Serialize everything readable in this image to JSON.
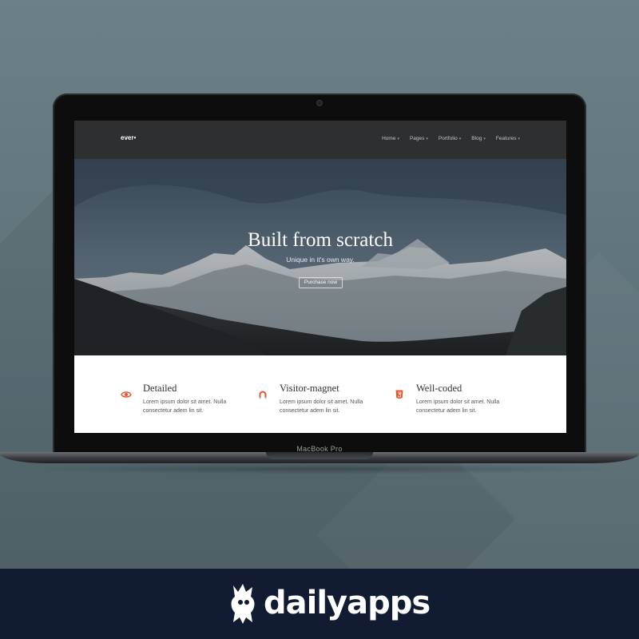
{
  "site": {
    "logo": "ever•",
    "nav": [
      {
        "label": "Home"
      },
      {
        "label": "Pages"
      },
      {
        "label": "Portfolio"
      },
      {
        "label": "Blog"
      },
      {
        "label": "Features"
      }
    ],
    "hero": {
      "title": "Built from scratch",
      "subtitle": "Unique in it's own way.",
      "cta_label": "Purchase now"
    },
    "features": [
      {
        "title": "Detailed",
        "text": "Lorem ipsum dolor sit amet. Nulla consectetur adem lin sit.",
        "icon": "eye-icon"
      },
      {
        "title": "Visitor-magnet",
        "text": "Lorem ipsum dolor sit amet. Nulla consectetur adem lin sit.",
        "icon": "magnet-icon"
      },
      {
        "title": "Well-coded",
        "text": "Lorem ipsum dolor sit amet. Nulla consectetur adem lin sit.",
        "icon": "html5-icon"
      }
    ],
    "accent_color": "#e8532f"
  },
  "device": {
    "label": "MacBook Pro"
  },
  "brand": {
    "name": "dailyapps"
  }
}
